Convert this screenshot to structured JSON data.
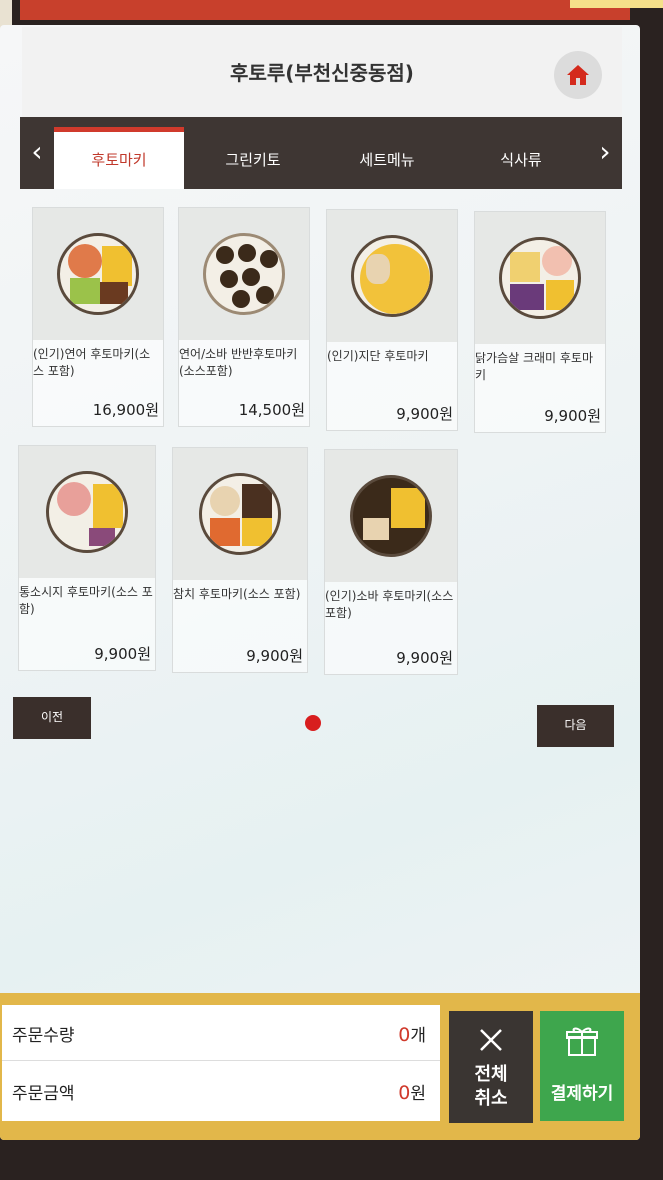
{
  "header": {
    "title": "후토루(부천신중동점)",
    "home_icon": "home-icon"
  },
  "tabs": [
    {
      "label": "후토마키",
      "active": true
    },
    {
      "label": "그린키토",
      "active": false
    },
    {
      "label": "세트메뉴",
      "active": false
    },
    {
      "label": "식사류",
      "active": false
    }
  ],
  "menu": [
    {
      "name": "(인기)연어 후토마키(소스 포함)",
      "price": "16,900원"
    },
    {
      "name": "연어/소바 반반후토마키(소스포함)",
      "price": "14,500원"
    },
    {
      "name": "(인기)지단 후토마키",
      "price": "9,900원"
    },
    {
      "name": "닭가슴살 크래미 후토마키",
      "price": "9,900원"
    },
    {
      "name": "통소시지 후토마키(소스 포함)",
      "price": "9,900원"
    },
    {
      "name": "참치 후토마키(소스 포함)",
      "price": "9,900원"
    },
    {
      "name": "(인기)소바 후토마키(소스 포함)",
      "price": "9,900원"
    }
  ],
  "pager": {
    "prev_label": "이전",
    "next_label": "다음"
  },
  "summary": {
    "qty_label": "주문수량",
    "qty_value": "0",
    "qty_unit": "개",
    "amount_label": "주문금액",
    "amount_value": "0",
    "amount_unit": "원"
  },
  "actions": {
    "cancel_line1": "전체",
    "cancel_line2": "취소",
    "pay_label": "결제하기"
  },
  "colors": {
    "accent_red": "#d03a2c",
    "tab_bg": "#3e3633",
    "pay_green": "#3ea64d",
    "bottom_gold": "#e2b74a"
  }
}
